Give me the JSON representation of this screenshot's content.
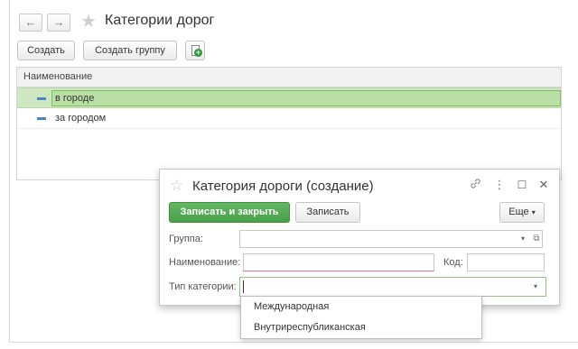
{
  "window": {
    "title": "Категории дорог"
  },
  "nav": {
    "back_glyph": "←",
    "forward_glyph": "→",
    "favorite_glyph": "★"
  },
  "toolbar": {
    "create_label": "Создать",
    "create_group_label": "Создать группу",
    "excel_icon": "create-from-excel-icon"
  },
  "list": {
    "column_header": "Наименование",
    "rows": [
      {
        "label": "в городе",
        "selected": true
      },
      {
        "label": "за городом",
        "selected": false
      }
    ]
  },
  "dialog": {
    "title": "Категория дороги (создание)",
    "star_glyph": "☆",
    "link_glyph": "🔗",
    "menu_glyph": "⋮",
    "maximize_glyph": "☐",
    "close_glyph": "✕",
    "save_close_label": "Записать и закрыть",
    "save_label": "Записать",
    "more_label": "Еще",
    "more_arrow": "▾",
    "group_label": "Группа:",
    "group_value": "",
    "name_label": "Наименование:",
    "name_value": "",
    "code_label": "Код:",
    "code_value": "",
    "type_label": "Тип категории:",
    "type_value": "",
    "dropdown_arrow": "▾",
    "open_glyph": "⧉"
  },
  "dropdown": {
    "options": [
      "Международная",
      "Внутриреспубликанская"
    ]
  },
  "colors": {
    "accent_green": "#46a046",
    "selected_row": "#cde8c1",
    "list_marker": "#4a86c5"
  }
}
